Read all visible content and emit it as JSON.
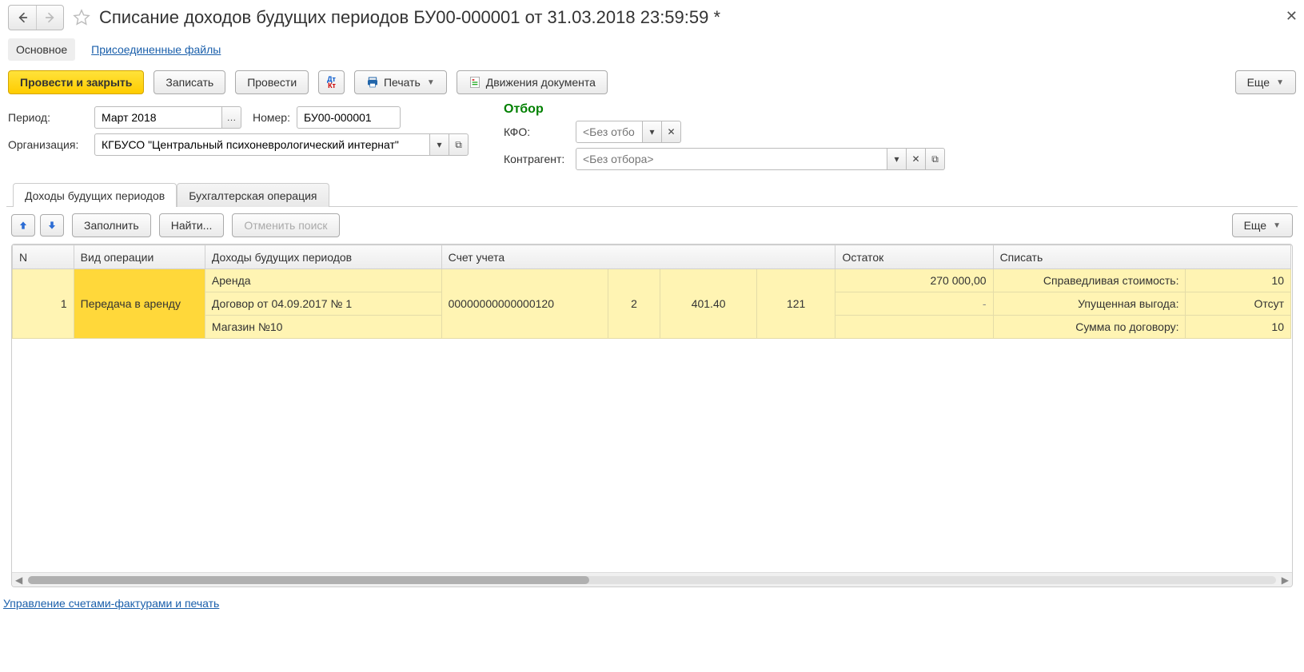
{
  "title": "Списание доходов будущих периодов БУ00-000001 от 31.03.2018 23:59:59 *",
  "nav": {
    "main": "Основное",
    "files": "Присоединенные файлы"
  },
  "toolbar": {
    "post_close": "Провести и закрыть",
    "save": "Записать",
    "post": "Провести",
    "print": "Печать",
    "movements": "Движения документа",
    "more": "Еще"
  },
  "form": {
    "period_lbl": "Период:",
    "period_val": "Март 2018",
    "number_lbl": "Номер:",
    "number_val": "БУ00-000001",
    "org_lbl": "Организация:",
    "org_val": "КГБУСО \"Центральный психоневрологический интернат\""
  },
  "filter": {
    "header": "Отбор",
    "kfo_lbl": "КФО:",
    "kfo_ph": "<Без отбо...",
    "contr_lbl": "Контрагент:",
    "contr_ph": "<Без отбора>"
  },
  "subtabs": {
    "income": "Доходы будущих периодов",
    "accop": "Бухгалтерская операция"
  },
  "gridbar": {
    "fill": "Заполнить",
    "find": "Найти...",
    "cancel_find": "Отменить поиск",
    "more": "Еще"
  },
  "cols": {
    "n": "N",
    "optype": "Вид операции",
    "income": "Доходы будущих периодов",
    "account": "Счет учета",
    "balance": "Остаток",
    "writeoff": "Списать"
  },
  "row": {
    "n": "1",
    "optype": "Передача в аренду",
    "income1": "Аренда",
    "income2": "Договор от 04.09.2017 № 1",
    "income3": "Магазин №10",
    "acc1": "00000000000000120",
    "acc2": "2",
    "acc3": "401.40",
    "acc4": "121",
    "balance1": "270 000,00",
    "balance2": "-",
    "wo_lbl1": "Справедливая стоимость:",
    "wo_lbl2": "Упущенная выгода:",
    "wo_lbl3": "Сумма по договору:",
    "wo_v1": "10",
    "wo_v2": "Отсут",
    "wo_v3": "10"
  },
  "footer_link": "Управление счетами-фактурами и печать"
}
